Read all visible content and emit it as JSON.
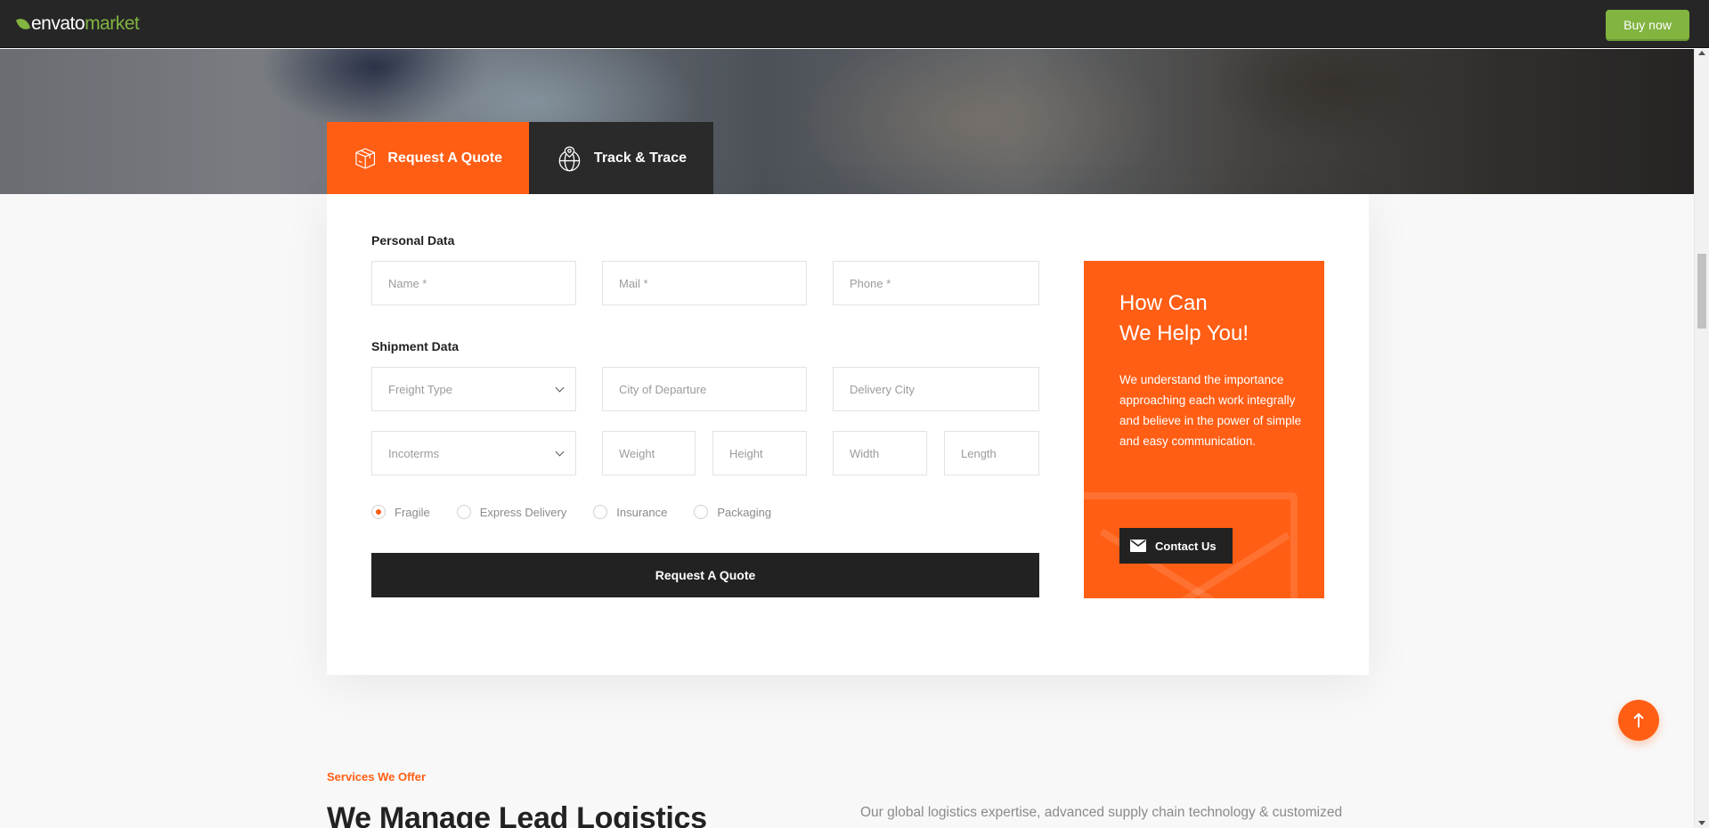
{
  "envato_bar": {
    "logo_brand": "envato",
    "logo_market": "market",
    "buy_now_label": "Buy now"
  },
  "tabs": [
    {
      "label": "Request A Quote",
      "icon": "box-icon",
      "active": true
    },
    {
      "label": "Track & Trace",
      "icon": "globe-pin-icon",
      "active": false
    }
  ],
  "form": {
    "personal_label": "Personal Data",
    "name_placeholder": "Name *",
    "mail_placeholder": "Mail *",
    "phone_placeholder": "Phone *",
    "shipment_label": "Shipment Data",
    "freight_type": "Freight Type",
    "city_departure_placeholder": "City of Departure",
    "delivery_city_placeholder": "Delivery City",
    "incoterms": "Incoterms",
    "weight_placeholder": "Weight",
    "height_placeholder": "Height",
    "width_placeholder": "Width",
    "length_placeholder": "Length",
    "options": [
      {
        "label": "Fragile",
        "checked": true
      },
      {
        "label": "Express Delivery",
        "checked": false
      },
      {
        "label": "Insurance",
        "checked": false
      },
      {
        "label": "Packaging",
        "checked": false
      }
    ],
    "submit_label": "Request A Quote"
  },
  "help": {
    "title_line1": "How Can",
    "title_line2": "We Help You!",
    "text": "We understand the importance approaching each work integrally and believe in the power of simple and easy communication.",
    "contact_label": "Contact Us"
  },
  "services": {
    "eyebrow": "Services We Offer",
    "heading": "We Manage Lead Logistics",
    "description": "Our global logistics expertise, advanced supply chain technology & customized"
  },
  "colors": {
    "accent": "#ff5e14",
    "dark": "#222222",
    "envato_green": "#82b440"
  }
}
